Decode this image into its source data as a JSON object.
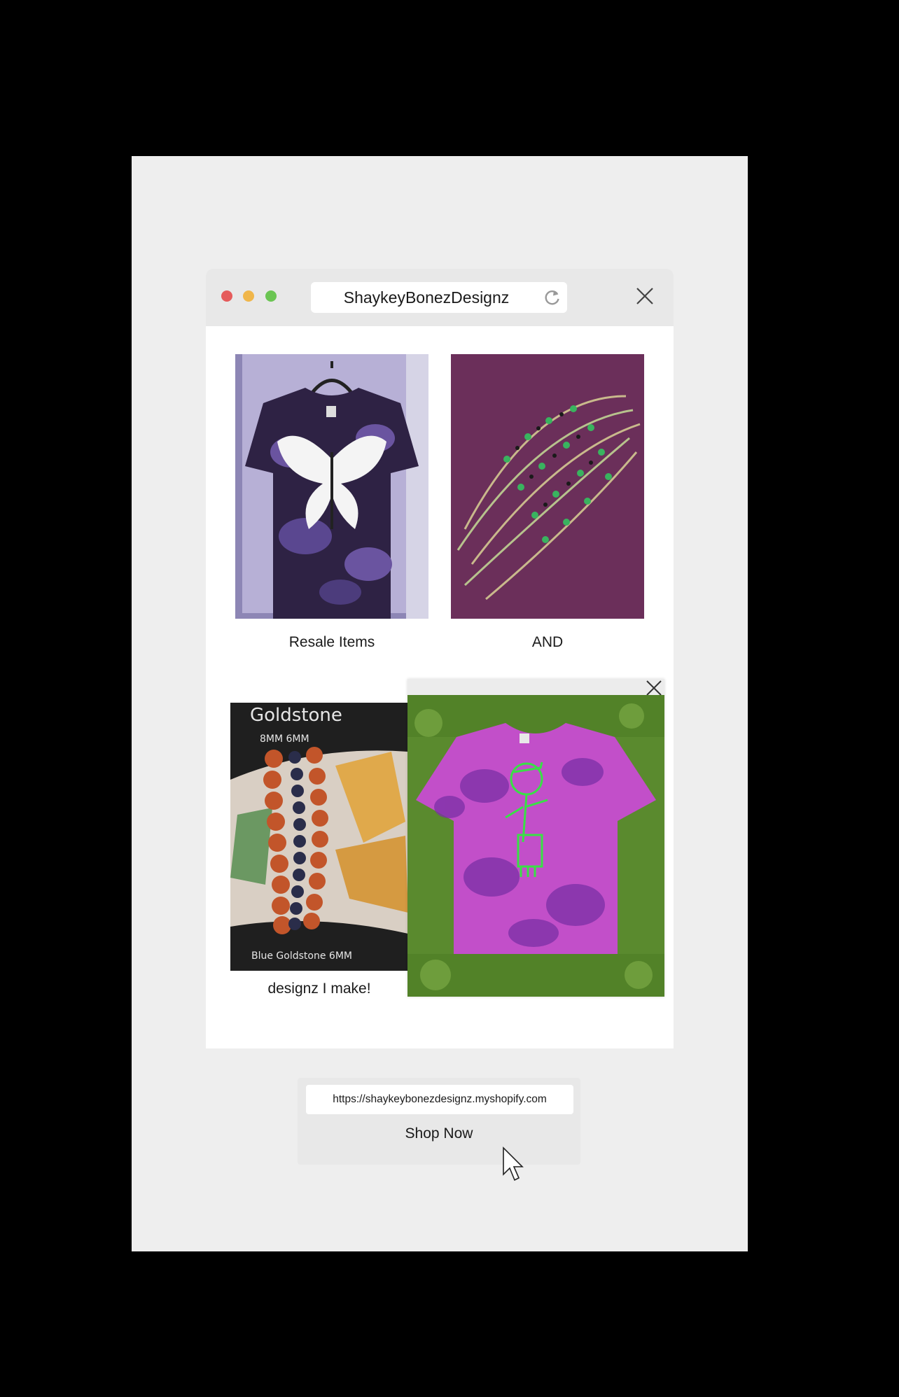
{
  "browser": {
    "title": "ShaykeyBonezDesignz",
    "refresh_icon": "refresh-icon",
    "close_icon": "close-icon"
  },
  "gallery": {
    "items": [
      {
        "caption": "Resale Items",
        "image": "purple tie-dye butterfly t-shirt"
      },
      {
        "caption": "AND",
        "image": "green beaded hemp necklaces"
      },
      {
        "caption": "designz I make!",
        "image": "goldstone bead bracelets"
      }
    ],
    "bracelet_text": {
      "title": "Goldstone",
      "sizes": "8MM  6MM",
      "footer": "Blue Goldstone 6MM"
    }
  },
  "popup": {
    "image": "pink tie-dye t-shirt with green figure on grass",
    "close_icon": "close-icon"
  },
  "shop": {
    "url": "https://shaykeybonezdesignz.myshopify.com",
    "button_label": "Shop Now"
  },
  "colors": {
    "panel": "#eeeeee",
    "titlebar": "#e8e8e8",
    "close_dot": "#e55b5b",
    "min_dot": "#f0b64a",
    "max_dot": "#6bc553"
  }
}
